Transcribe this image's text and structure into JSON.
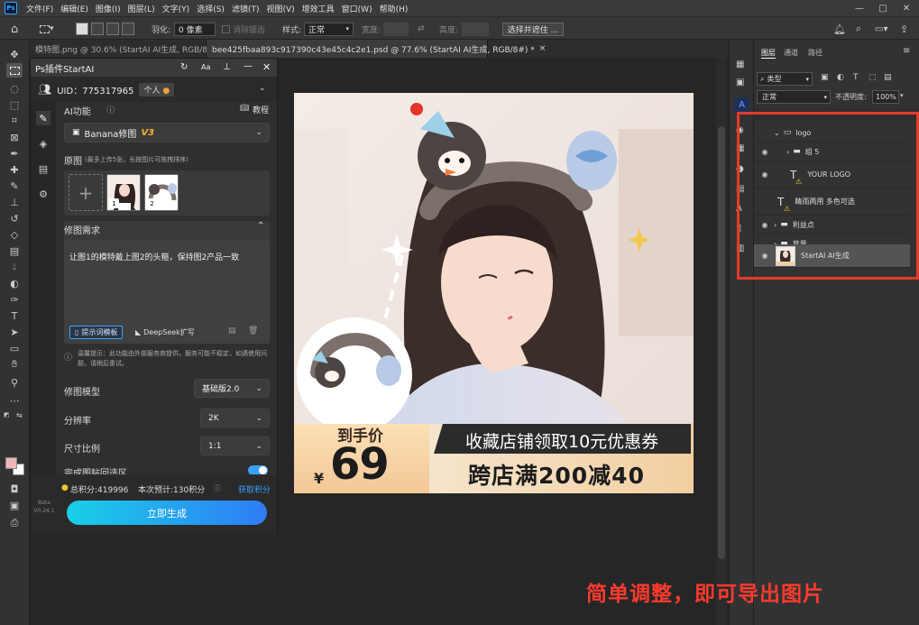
{
  "menubar": {
    "logo": "Ps",
    "items": [
      "文件(F)",
      "编辑(E)",
      "图像(I)",
      "图层(L)",
      "文字(Y)",
      "选择(S)",
      "滤镜(T)",
      "视图(V)",
      "增效工具",
      "窗口(W)",
      "帮助(H)"
    ],
    "window_controls": [
      "—",
      "□",
      "✕"
    ]
  },
  "options_bar": {
    "feather_label": "羽化:",
    "feather_value": "0 像素",
    "antialias_label": "消除锯齿",
    "style_label": "样式:",
    "style_value": "正常",
    "width_label": "宽度:",
    "height_label": "高度:",
    "select_mask_button": "选择并遮住 ..."
  },
  "tabs": [
    {
      "label": "模特图.png @ 30.6% (StartAI AI生成, RGB/8#) *",
      "close": "×"
    },
    {
      "label": "bee425fbaa893c917390c43e45c4c2e1.psd @ 77.6% (StartAI AI生成, RGB/8#) *",
      "close": "×"
    }
  ],
  "plugin": {
    "title": "Ps插件StartAI",
    "uid_label": "UID：775317965",
    "account_type": "个人",
    "ai_function_label": "AI功能",
    "tutorial_label": "教程",
    "model_select": "Banana修图",
    "model_version": "V3",
    "source_label": "原图",
    "source_hint": "(最多上传5张，长按图片可拖拽排序)",
    "thumb_numbers": [
      "1",
      "2"
    ],
    "requirement_label": "修图需求",
    "prompt_text": "让图1的模特戴上图2的头箍，保持图2产品一致",
    "prompt_template_chip": "提示词模板",
    "deepseek_chip": "DeepSeek扩写",
    "notice": "温馨提示：此功能由外部服务商提供，服务可能不稳定，如遇使用问题，请稍后重试。",
    "model_label": "修图模型",
    "model_value": "基础版2.0",
    "resolution_label": "分辨率",
    "resolution_value": "2K",
    "ratio_label": "尺寸比例",
    "ratio_value": "1:1",
    "auto_paste_label": "完成图贴回选区",
    "total_points": "总积分:419996",
    "estimate": "本次预计:130积分",
    "get_points": "获取积分",
    "generate_button": "立即生成",
    "version": "Beta V0.24.1"
  },
  "canvas_banner": {
    "price_label": "到手价",
    "currency": "¥",
    "price": "69",
    "coupon_text": "收藏店铺领取10元优惠券",
    "promo_text": "跨店满200减40"
  },
  "layers_panel": {
    "tabs": [
      "图层",
      "通道",
      "路径"
    ],
    "filter_label": "类型",
    "blend_mode": "正常",
    "opacity_label": "不透明度:",
    "opacity_value": "100%",
    "layers": [
      {
        "name": "logo",
        "kind": "group"
      },
      {
        "name": "组 5",
        "kind": "group"
      },
      {
        "name": "YOUR LOGO",
        "kind": "text"
      },
      {
        "name": "睛雨两用 多色可选",
        "kind": "text"
      },
      {
        "name": "利益点",
        "kind": "group"
      },
      {
        "name": "背景",
        "kind": "group"
      },
      {
        "name": "StartAI AI生成",
        "kind": "image"
      }
    ]
  },
  "caption": "简单调整，即可导出图片",
  "colors": {
    "accent_red": "#e63a2a",
    "generate_gradient_start": "#18d0e8",
    "generate_gradient_end": "#2f7cf6",
    "link_blue": "#3aa0ff"
  }
}
